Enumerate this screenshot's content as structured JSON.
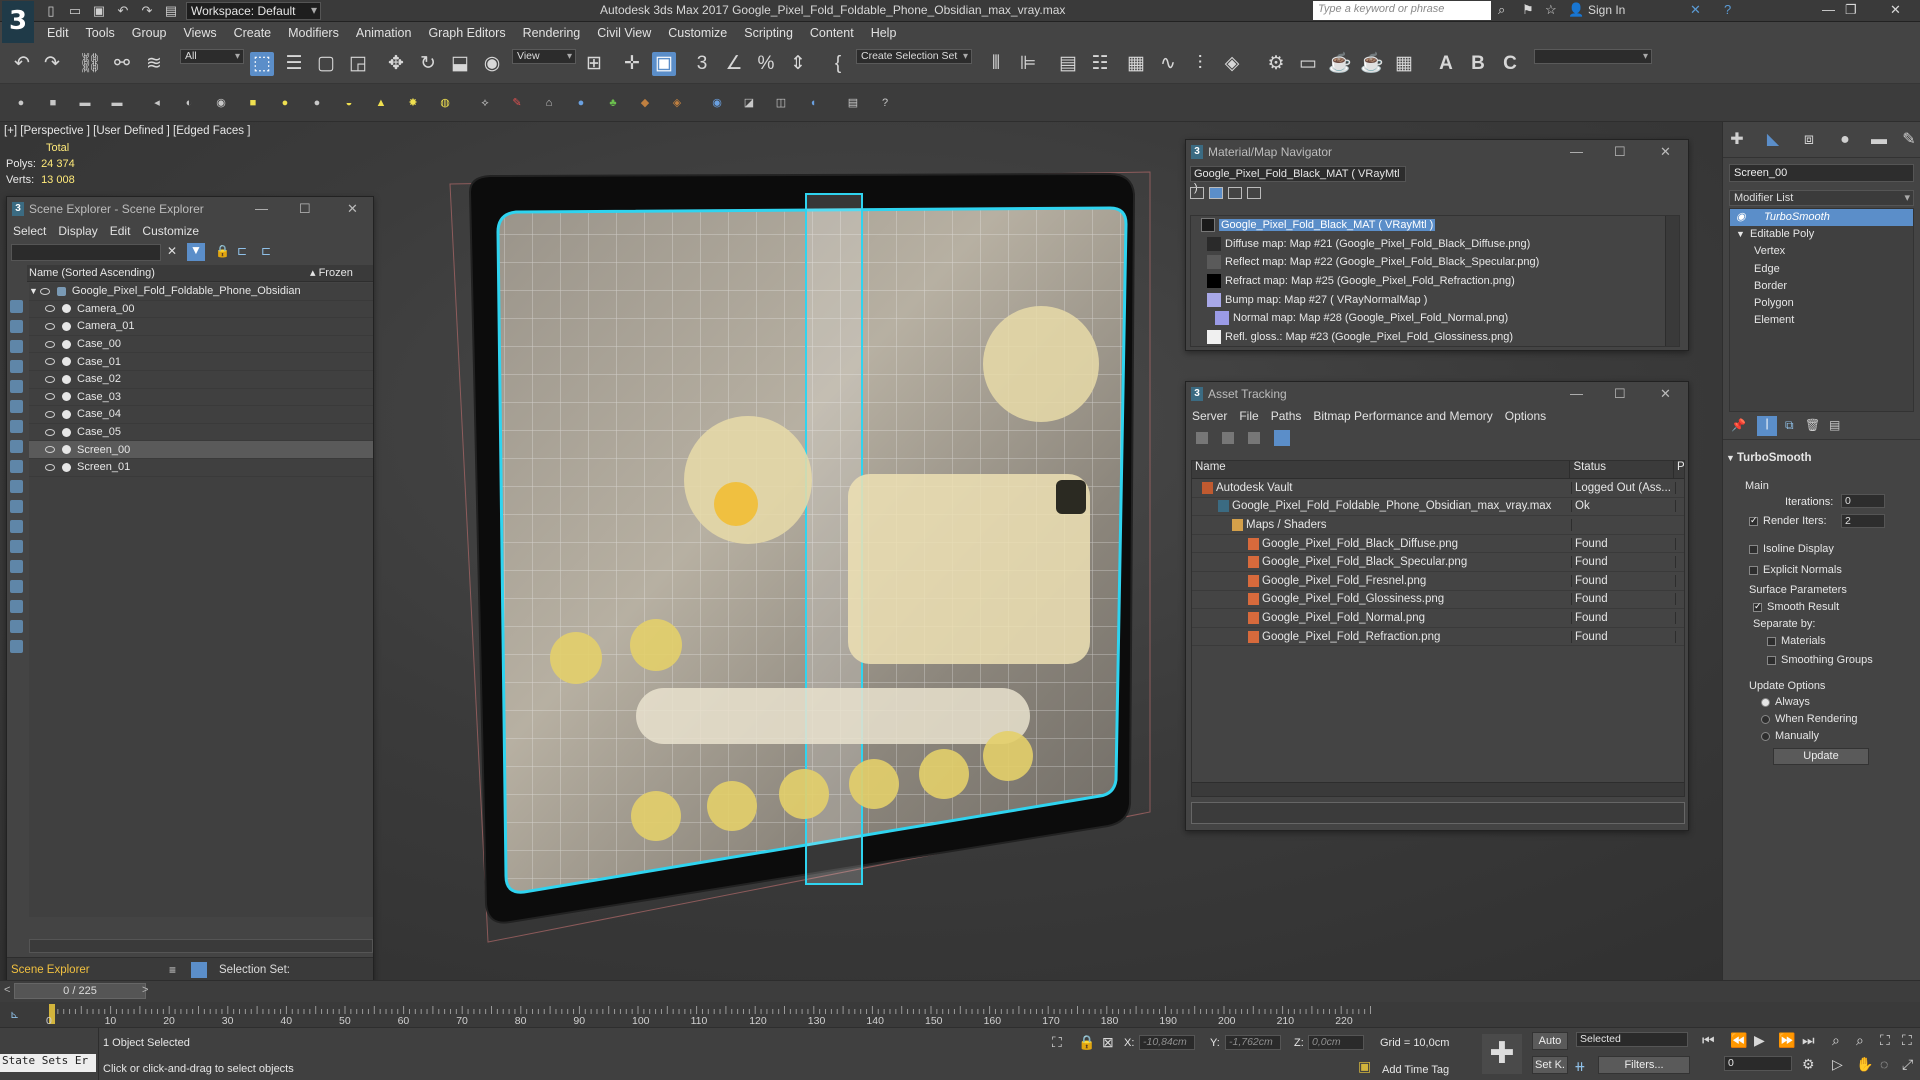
{
  "window": {
    "title": "Autodesk 3ds Max 2017        Google_Pixel_Fold_Foldable_Phone_Obsidian_max_vray.max",
    "workspace": "Workspace: Default",
    "search_placeholder": "Type a keyword or phrase",
    "sign_in": "Sign In"
  },
  "menu": [
    "Edit",
    "Tools",
    "Group",
    "Views",
    "Create",
    "Modifiers",
    "Animation",
    "Graph Editors",
    "Rendering",
    "Civil View",
    "Customize",
    "Scripting",
    "Content",
    "Help"
  ],
  "toolbar": {
    "filter_value": "All",
    "refcoord_value": "View",
    "selection_set_label": "Create Selection Set"
  },
  "viewport": {
    "label": "[+] [Perspective ] [User Defined ] [Edged Faces ]",
    "stats_total": "Total",
    "polys_label": "Polys:",
    "polys_value": "24 374",
    "verts_label": "Verts:",
    "verts_value": "13 008"
  },
  "scene_explorer": {
    "title": "Scene Explorer - Scene Explorer",
    "menu": [
      "Select",
      "Display",
      "Edit",
      "Customize"
    ],
    "col_name": "Name (Sorted Ascending)",
    "col_frozen": "▴ Frozen",
    "root": "Google_Pixel_Fold_Foldable_Phone_Obsidian",
    "items": [
      "Camera_00",
      "Camera_01",
      "Case_00",
      "Case_01",
      "Case_02",
      "Case_03",
      "Case_04",
      "Case_05",
      "Screen_00",
      "Screen_01"
    ],
    "selected_item": "Screen_00",
    "footer_label": "Scene Explorer",
    "selection_set_label": "Selection Set:"
  },
  "material_navigator": {
    "title": "Material/Map Navigator",
    "current": "Google_Pixel_Fold_Black_MAT  ( VRayMtl )",
    "root": "Google_Pixel_Fold_Black_MAT  ( VRayMtl )",
    "maps": [
      {
        "text": "Diffuse map: Map #21 (Google_Pixel_Fold_Black_Diffuse.png)",
        "swatch": "#2a2a2a"
      },
      {
        "text": "Reflect map: Map #22 (Google_Pixel_Fold_Black_Specular.png)",
        "swatch": "#5a5a5a"
      },
      {
        "text": "Refract map: Map #25 (Google_Pixel_Fold_Refraction.png)",
        "swatch": "#000000"
      },
      {
        "text": "Bump map: Map #27  ( VRayNormalMap )",
        "swatch": "#a8a8e8"
      },
      {
        "text": "Normal map: Map #28 (Google_Pixel_Fold_Normal.png)",
        "swatch": "#9a9ae6"
      },
      {
        "text": "Refl. gloss.: Map #23 (Google_Pixel_Fold_Glossiness.png)",
        "swatch": "#f0f0f0"
      }
    ]
  },
  "asset_tracking": {
    "title": "Asset Tracking",
    "menu": [
      "Server",
      "File",
      "Paths",
      "Bitmap Performance and Memory",
      "Options"
    ],
    "col_name": "Name",
    "col_status": "Status",
    "col_p": "P",
    "rows": [
      {
        "name": "Autodesk Vault",
        "status": "Logged Out (Ass..."
      },
      {
        "name": "Google_Pixel_Fold_Foldable_Phone_Obsidian_max_vray.max",
        "status": "Ok"
      },
      {
        "name": "Maps / Shaders",
        "status": ""
      },
      {
        "name": "Google_Pixel_Fold_Black_Diffuse.png",
        "status": "Found"
      },
      {
        "name": "Google_Pixel_Fold_Black_Specular.png",
        "status": "Found"
      },
      {
        "name": "Google_Pixel_Fold_Fresnel.png",
        "status": "Found"
      },
      {
        "name": "Google_Pixel_Fold_Glossiness.png",
        "status": "Found"
      },
      {
        "name": "Google_Pixel_Fold_Normal.png",
        "status": "Found"
      },
      {
        "name": "Google_Pixel_Fold_Refraction.png",
        "status": "Found"
      }
    ]
  },
  "command_panel": {
    "object_name": "Screen_00",
    "modifier_list": "Modifier List",
    "stack": [
      "TurboSmooth",
      "Editable Poly",
      "Vertex",
      "Edge",
      "Border",
      "Polygon",
      "Element"
    ],
    "turbosmooth": {
      "title": "TurboSmooth",
      "main": "Main",
      "iterations_label": "Iterations:",
      "iterations_value": "0",
      "render_iters_label": "Render Iters:",
      "render_iters_value": "2",
      "isoline": "Isoline Display",
      "explicit_normals": "Explicit Normals",
      "surface_params": "Surface Parameters",
      "smooth_result": "Smooth Result",
      "separate_by": "Separate by:",
      "materials": "Materials",
      "smoothing_groups": "Smoothing Groups",
      "update_options": "Update Options",
      "always": "Always",
      "when_rendering": "When Rendering",
      "manually": "Manually",
      "update_button": "Update"
    }
  },
  "timeline": {
    "frame": "0 / 225",
    "ticks": [
      "0",
      "10",
      "20",
      "30",
      "40",
      "50",
      "60",
      "70",
      "80",
      "90",
      "100",
      "110",
      "120",
      "130",
      "140",
      "150",
      "160",
      "170",
      "180",
      "190",
      "200",
      "210",
      "220"
    ]
  },
  "status": {
    "objects_selected": "1 Object Selected",
    "hint": "Click or click-and-drag to select objects",
    "script_listener": "State Sets Er",
    "x_label": "X:",
    "x_value": "-10,84cm",
    "y_label": "Y:",
    "y_value": "-1,762cm",
    "z_label": "Z:",
    "z_value": "0,0cm",
    "grid": "Grid = 10,0cm",
    "add_time_tag": "Add Time Tag",
    "auto": "Auto",
    "set_key": "Set K.",
    "selected": "Selected",
    "filters": "Filters...",
    "frame_field": "0"
  }
}
